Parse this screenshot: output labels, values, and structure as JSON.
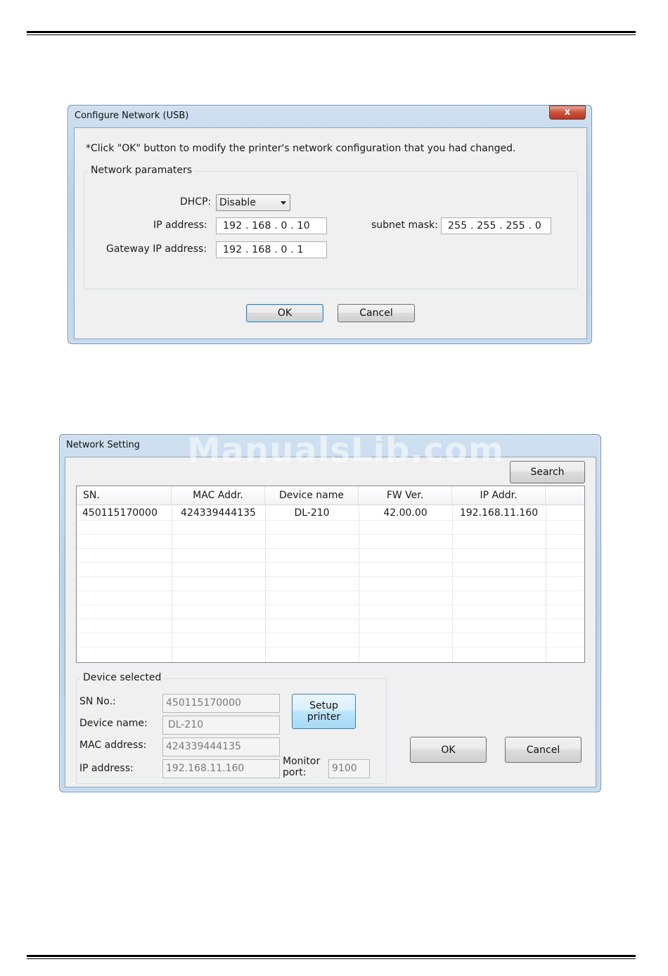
{
  "dialog1": {
    "title": "Configure Network (USB)",
    "close_glyph": "x",
    "instruction": "*Click \"OK\" button to modify the printer's network configuration that you had changed.",
    "group_label": "Network paramaters",
    "dhcp": {
      "label": "DHCP:",
      "value": "Disable"
    },
    "ip_address": {
      "label": "IP address:",
      "value": "192 . 168 .  0   .  10"
    },
    "subnet_mask": {
      "label": "subnet mask:",
      "value": "255 . 255 . 255 .   0"
    },
    "gateway": {
      "label": "Gateway IP address:",
      "value": "192 . 168 .  0   .   1"
    },
    "ok_label": "OK",
    "cancel_label": "Cancel"
  },
  "dialog2": {
    "title": "Network Setting",
    "watermark": "ManualsLib.com",
    "search_label": "Search",
    "columns": [
      "SN.",
      "MAC Addr.",
      "Device name",
      "FW Ver.",
      "IP Addr."
    ],
    "rows": [
      [
        "450115170000",
        "424339444135",
        "DL-210",
        "42.00.00",
        "192.168.11.160"
      ]
    ],
    "device_selected": {
      "group_label": "Device selected",
      "sn": {
        "label": "SN No.:",
        "value": "450115170000"
      },
      "device_name": {
        "label": "Device name:",
        "value": "DL-210"
      },
      "mac": {
        "label": "MAC address:",
        "value": "424339444135"
      },
      "ip": {
        "label": "IP address:",
        "value": "192.168.11.160"
      },
      "monitor_port": {
        "label_line1": "Monitor",
        "label_line2": "port:",
        "value": "9100"
      },
      "setup_line1": "Setup",
      "setup_line2": "printer"
    },
    "ok_label": "OK",
    "cancel_label": "Cancel"
  }
}
